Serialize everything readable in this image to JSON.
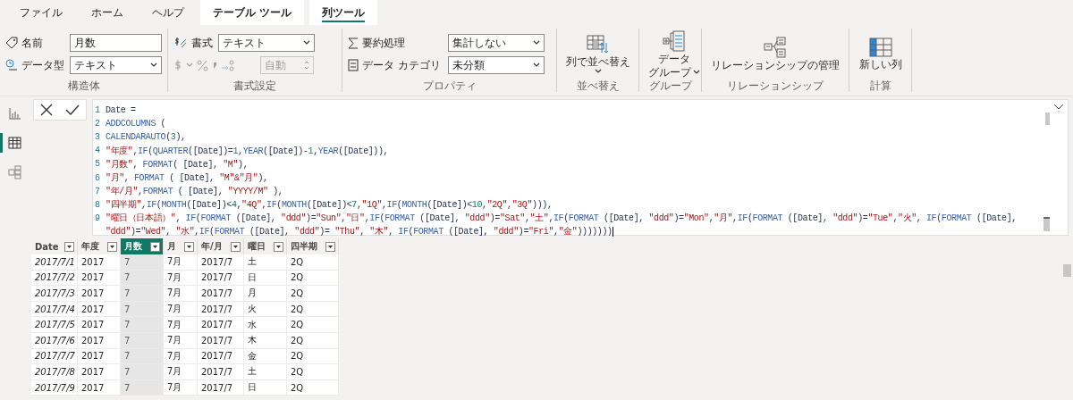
{
  "tabs": [
    {
      "label": "ファイル",
      "kind": "normal",
      "selected": false
    },
    {
      "label": "ホーム",
      "kind": "normal",
      "selected": false
    },
    {
      "label": "ヘルプ",
      "kind": "normal",
      "selected": false
    },
    {
      "label": "テーブル ツール",
      "kind": "contextual",
      "selected": false
    },
    {
      "label": "列ツール",
      "kind": "contextual",
      "selected": true
    }
  ],
  "ribbon": {
    "structure": {
      "name_label": "名前",
      "name_value": "月数",
      "type_label": "データ型",
      "type_value": "テキスト",
      "group_label": "構造体"
    },
    "format": {
      "format_label": "書式",
      "format_value": "テキスト",
      "decimal_value": "自動",
      "disabled": true,
      "group_label": "書式設定"
    },
    "properties": {
      "summary_label": "要約処理",
      "summary_value": "集計しない",
      "category_label": "データ カテゴリ",
      "category_value": "未分類",
      "group_label": "プロパティ"
    },
    "groups": [
      {
        "kind": "sort",
        "button": [
          "列で並べ替え"
        ],
        "dropdown": true,
        "group_label": "並べ替え"
      },
      {
        "kind": "group",
        "button": [
          "データ",
          "グループ"
        ],
        "dropdown": true,
        "group_label": "グループ"
      },
      {
        "kind": "relation",
        "button": [
          "リレーションシップの管理"
        ],
        "dropdown": false,
        "group_label": "リレーションシップ"
      },
      {
        "kind": "column",
        "button": [
          "新しい列"
        ],
        "dropdown": false,
        "group_label": "計算"
      }
    ]
  },
  "nav": [
    {
      "kind": "report",
      "selected": false
    },
    {
      "kind": "data",
      "selected": true
    },
    {
      "kind": "model",
      "selected": false
    }
  ],
  "formula": {
    "lines": [
      {
        "number": "1",
        "tokens": [
          {
            "kind": "plain",
            "text": "Date ="
          }
        ]
      },
      {
        "number": "2",
        "tokens": [
          {
            "kind": "func",
            "text": "ADDCOLUMNS"
          },
          {
            "kind": "plain",
            "text": " ("
          }
        ]
      },
      {
        "number": "3",
        "tokens": [
          {
            "kind": "func",
            "text": "CALENDARAUTO"
          },
          {
            "kind": "plain",
            "text": "("
          },
          {
            "kind": "num",
            "text": "3"
          },
          {
            "kind": "plain",
            "text": "),"
          }
        ]
      },
      {
        "number": "4",
        "tokens": [
          {
            "kind": "str",
            "text": "\"年度\""
          },
          {
            "kind": "plain",
            "text": ","
          },
          {
            "kind": "func",
            "text": "IF"
          },
          {
            "kind": "plain",
            "text": "("
          },
          {
            "kind": "func",
            "text": "QUARTER"
          },
          {
            "kind": "plain",
            "text": "([Date])="
          },
          {
            "kind": "num",
            "text": "1"
          },
          {
            "kind": "plain",
            "text": ","
          },
          {
            "kind": "func",
            "text": "YEAR"
          },
          {
            "kind": "plain",
            "text": "([Date])-"
          },
          {
            "kind": "num",
            "text": "1"
          },
          {
            "kind": "plain",
            "text": ","
          },
          {
            "kind": "func",
            "text": "YEAR"
          },
          {
            "kind": "plain",
            "text": "([Date])),"
          }
        ]
      },
      {
        "number": "5",
        "tokens": [
          {
            "kind": "str",
            "text": "\"月数\""
          },
          {
            "kind": "plain",
            "text": ", "
          },
          {
            "kind": "func",
            "text": "FORMAT"
          },
          {
            "kind": "plain",
            "text": "( [Date], "
          },
          {
            "kind": "str",
            "text": "\"M\""
          },
          {
            "kind": "plain",
            "text": "),"
          }
        ]
      },
      {
        "number": "6",
        "tokens": [
          {
            "kind": "str",
            "text": "\"月\""
          },
          {
            "kind": "plain",
            "text": ", "
          },
          {
            "kind": "func",
            "text": "FORMAT"
          },
          {
            "kind": "plain",
            "text": " ( [Date], "
          },
          {
            "kind": "str",
            "text": "\"M\"&\"月\""
          },
          {
            "kind": "plain",
            "text": "),"
          }
        ]
      },
      {
        "number": "7",
        "tokens": [
          {
            "kind": "str",
            "text": "\"年/月\""
          },
          {
            "kind": "plain",
            "text": ","
          },
          {
            "kind": "func",
            "text": "FORMAT"
          },
          {
            "kind": "plain",
            "text": " ( [Date], "
          },
          {
            "kind": "str",
            "text": "\"YYYY/M\""
          },
          {
            "kind": "plain",
            "text": " ),"
          }
        ]
      },
      {
        "number": "8",
        "tokens": [
          {
            "kind": "str",
            "text": "\"四半期\""
          },
          {
            "kind": "plain",
            "text": ","
          },
          {
            "kind": "func",
            "text": "IF"
          },
          {
            "kind": "plain",
            "text": "("
          },
          {
            "kind": "func",
            "text": "MONTH"
          },
          {
            "kind": "plain",
            "text": "([Date])<"
          },
          {
            "kind": "num",
            "text": "4"
          },
          {
            "kind": "plain",
            "text": ","
          },
          {
            "kind": "str",
            "text": "\"4Q\""
          },
          {
            "kind": "plain",
            "text": ","
          },
          {
            "kind": "func",
            "text": "IF"
          },
          {
            "kind": "plain",
            "text": "("
          },
          {
            "kind": "func",
            "text": "MONTH"
          },
          {
            "kind": "plain",
            "text": "([Date])<"
          },
          {
            "kind": "num",
            "text": "7"
          },
          {
            "kind": "plain",
            "text": ","
          },
          {
            "kind": "str",
            "text": "\"1Q\""
          },
          {
            "kind": "plain",
            "text": ","
          },
          {
            "kind": "func",
            "text": "IF"
          },
          {
            "kind": "plain",
            "text": "("
          },
          {
            "kind": "func",
            "text": "MONTH"
          },
          {
            "kind": "plain",
            "text": "([Date])<"
          },
          {
            "kind": "num",
            "text": "10"
          },
          {
            "kind": "plain",
            "text": ","
          },
          {
            "kind": "str",
            "text": "\"2Q\""
          },
          {
            "kind": "plain",
            "text": ","
          },
          {
            "kind": "str",
            "text": "\"3Q\""
          },
          {
            "kind": "plain",
            "text": "))),"
          }
        ]
      },
      {
        "number": "9",
        "tokens": [
          {
            "kind": "str",
            "text": "\"曜日（日本語）\""
          },
          {
            "kind": "plain",
            "text": ", "
          },
          {
            "kind": "func",
            "text": "IF"
          },
          {
            "kind": "plain",
            "text": "("
          },
          {
            "kind": "func",
            "text": "FORMAT"
          },
          {
            "kind": "plain",
            "text": " ([Date], "
          },
          {
            "kind": "str",
            "text": "\"ddd\""
          },
          {
            "kind": "plain",
            "text": ")="
          },
          {
            "kind": "str",
            "text": "\"Sun\""
          },
          {
            "kind": "plain",
            "text": ","
          },
          {
            "kind": "str",
            "text": "\"日\""
          },
          {
            "kind": "plain",
            "text": ","
          },
          {
            "kind": "func",
            "text": "IF"
          },
          {
            "kind": "plain",
            "text": "("
          },
          {
            "kind": "func",
            "text": "FORMAT"
          },
          {
            "kind": "plain",
            "text": " ([Date], "
          },
          {
            "kind": "str",
            "text": "\"ddd\""
          },
          {
            "kind": "plain",
            "text": ")="
          },
          {
            "kind": "str",
            "text": "\"Sat\""
          },
          {
            "kind": "plain",
            "text": ","
          },
          {
            "kind": "str",
            "text": "\"土\""
          },
          {
            "kind": "plain",
            "text": ","
          },
          {
            "kind": "func",
            "text": "IF"
          },
          {
            "kind": "plain",
            "text": "("
          },
          {
            "kind": "func",
            "text": "FORMAT"
          },
          {
            "kind": "plain",
            "text": " ([Date], "
          },
          {
            "kind": "str",
            "text": "\"ddd\""
          },
          {
            "kind": "plain",
            "text": ")="
          },
          {
            "kind": "str",
            "text": "\"Mon\""
          },
          {
            "kind": "plain",
            "text": ","
          },
          {
            "kind": "str",
            "text": "\"月\""
          },
          {
            "kind": "plain",
            "text": ","
          },
          {
            "kind": "func",
            "text": "IF"
          },
          {
            "kind": "plain",
            "text": "("
          },
          {
            "kind": "func",
            "text": "FORMAT"
          },
          {
            "kind": "plain",
            "text": " ([Date], "
          },
          {
            "kind": "str",
            "text": "\"ddd\""
          },
          {
            "kind": "plain",
            "text": ")="
          },
          {
            "kind": "str",
            "text": "\"Tue\""
          },
          {
            "kind": "plain",
            "text": ","
          },
          {
            "kind": "str",
            "text": "\"火\""
          },
          {
            "kind": "plain",
            "text": ", "
          },
          {
            "kind": "func",
            "text": "IF"
          },
          {
            "kind": "plain",
            "text": "("
          },
          {
            "kind": "func",
            "text": "FORMAT"
          },
          {
            "kind": "plain",
            "text": " ([Date],"
          }
        ]
      },
      {
        "tokens": [
          {
            "kind": "str",
            "text": "\"ddd\""
          },
          {
            "kind": "plain",
            "text": ")="
          },
          {
            "kind": "str",
            "text": "\"Wed\""
          },
          {
            "kind": "plain",
            "text": ", "
          },
          {
            "kind": "str",
            "text": "\"水\""
          },
          {
            "kind": "plain",
            "text": ","
          },
          {
            "kind": "func",
            "text": "IF"
          },
          {
            "kind": "plain",
            "text": "("
          },
          {
            "kind": "func",
            "text": "FORMAT"
          },
          {
            "kind": "plain",
            "text": " ([Date], "
          },
          {
            "kind": "str",
            "text": "\"ddd\""
          },
          {
            "kind": "plain",
            "text": ")= "
          },
          {
            "kind": "str",
            "text": "\"Thu\""
          },
          {
            "kind": "plain",
            "text": ", "
          },
          {
            "kind": "str",
            "text": "\"木\""
          },
          {
            "kind": "plain",
            "text": ", "
          },
          {
            "kind": "func",
            "text": "IF"
          },
          {
            "kind": "plain",
            "text": "("
          },
          {
            "kind": "func",
            "text": "FORMAT"
          },
          {
            "kind": "plain",
            "text": " ([Date], "
          },
          {
            "kind": "str",
            "text": "\"ddd\""
          },
          {
            "kind": "plain",
            "text": ")="
          },
          {
            "kind": "str",
            "text": "\"Fri\""
          },
          {
            "kind": "plain",
            "text": ","
          },
          {
            "kind": "str",
            "text": "\"金\""
          },
          {
            "kind": "plain",
            "text": ")))))))"
          }
        ]
      }
    ]
  },
  "table": {
    "columns": [
      {
        "label": "Date",
        "selected": false
      },
      {
        "label": "年度",
        "selected": false
      },
      {
        "label": "月数",
        "selected": true
      },
      {
        "label": "月",
        "selected": false
      },
      {
        "label": "年/月",
        "selected": false
      },
      {
        "label": "曜日",
        "selected": false
      },
      {
        "label": "四半期",
        "selected": false
      }
    ],
    "rows": [
      [
        "2017/7/1",
        "2017",
        "7",
        "7月",
        "2017/7",
        "土",
        "2Q"
      ],
      [
        "2017/7/2",
        "2017",
        "7",
        "7月",
        "2017/7",
        "日",
        "2Q"
      ],
      [
        "2017/7/3",
        "2017",
        "7",
        "7月",
        "2017/7",
        "月",
        "2Q"
      ],
      [
        "2017/7/4",
        "2017",
        "7",
        "7月",
        "2017/7",
        "火",
        "2Q"
      ],
      [
        "2017/7/5",
        "2017",
        "7",
        "7月",
        "2017/7",
        "水",
        "2Q"
      ],
      [
        "2017/7/6",
        "2017",
        "7",
        "7月",
        "2017/7",
        "木",
        "2Q"
      ],
      [
        "2017/7/7",
        "2017",
        "7",
        "7月",
        "2017/7",
        "金",
        "2Q"
      ],
      [
        "2017/7/8",
        "2017",
        "7",
        "7月",
        "2017/7",
        "土",
        "2Q"
      ],
      [
        "2017/7/9",
        "2017",
        "7",
        "7月",
        "2017/7",
        "日",
        "2Q"
      ]
    ]
  }
}
